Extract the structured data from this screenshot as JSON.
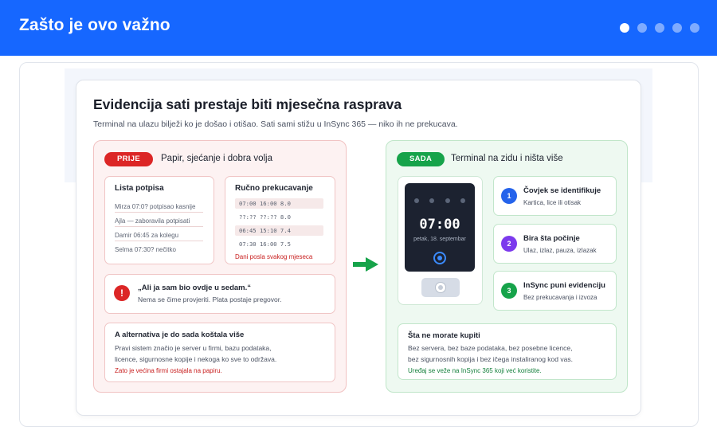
{
  "header": {
    "title": "Zašto je ovo važno",
    "page_dots": 5,
    "active_dot": 0,
    "color": "#1667ff"
  },
  "slide": {
    "title": "Evidencija sati prestaje biti mjesečna rasprava",
    "subtitle": "Terminal na ulazu bilježi ko je došao i otišao. Sati sami stižu u InSync 365 — niko ih ne prekucava."
  },
  "before": {
    "badge": "PRIJE",
    "heading": "Papir, sjećanje i dobra volja",
    "signatures": {
      "title": "Lista potpisa",
      "rows": [
        "Mirza 07:0? potpisao kasnije",
        "Ajla — zaboravila potpisati",
        "Damir 06:45 za kolegu",
        "Selma 07:30? nečitko"
      ]
    },
    "manual": {
      "title": "Ručno prekucavanje",
      "rows": [
        "07:00 16:00 8.0",
        "??:?? ??:?? 8.0",
        "06:45 15:10 7.4",
        "07:30 16:00 7.5"
      ],
      "note": "Dani posla svakog mjeseca"
    },
    "quote": {
      "title": "„Ali ja sam bio ovdje u sedam.“",
      "text": "Nema se čime provjeriti. Plata postaje pregovor."
    },
    "alternative": {
      "title": "A alternativa je do sada koštala više",
      "line1": "Pravi sistem značio je server u firmi, bazu podataka,",
      "line2": "licence, sigurnosne kopije i nekoga ko sve to održava.",
      "note": "Zato je većina firmi ostajala na papiru."
    },
    "color": "#dc2626"
  },
  "after": {
    "badge": "SADA",
    "heading": "Terminal na zidu i ništa više",
    "terminal": {
      "time": "07:00",
      "date": "petak, 18. septembar"
    },
    "steps": [
      {
        "num": "1",
        "title": "Čovjek se identifikuje",
        "desc": "Kartica, lice ili otisak",
        "color": "#2563eb"
      },
      {
        "num": "2",
        "title": "Bira šta počinje",
        "desc": "Ulaz, izlaz, pauza, izlazak",
        "color": "#7c3aed"
      },
      {
        "num": "3",
        "title": "InSync puni evidenciju",
        "desc": "Bez prekucavanja i izvoza",
        "color": "#16a34a"
      }
    ],
    "no_buy": {
      "title": "Šta ne morate kupiti",
      "line1": "Bez servera, bez baze podataka, bez posebne licence,",
      "line2": "bez sigurnosnih kopija i bez ičega instaliranog kod vas.",
      "note": "Uređaj se veže na InSync 365 koji već koristite."
    },
    "color": "#16a34a"
  }
}
